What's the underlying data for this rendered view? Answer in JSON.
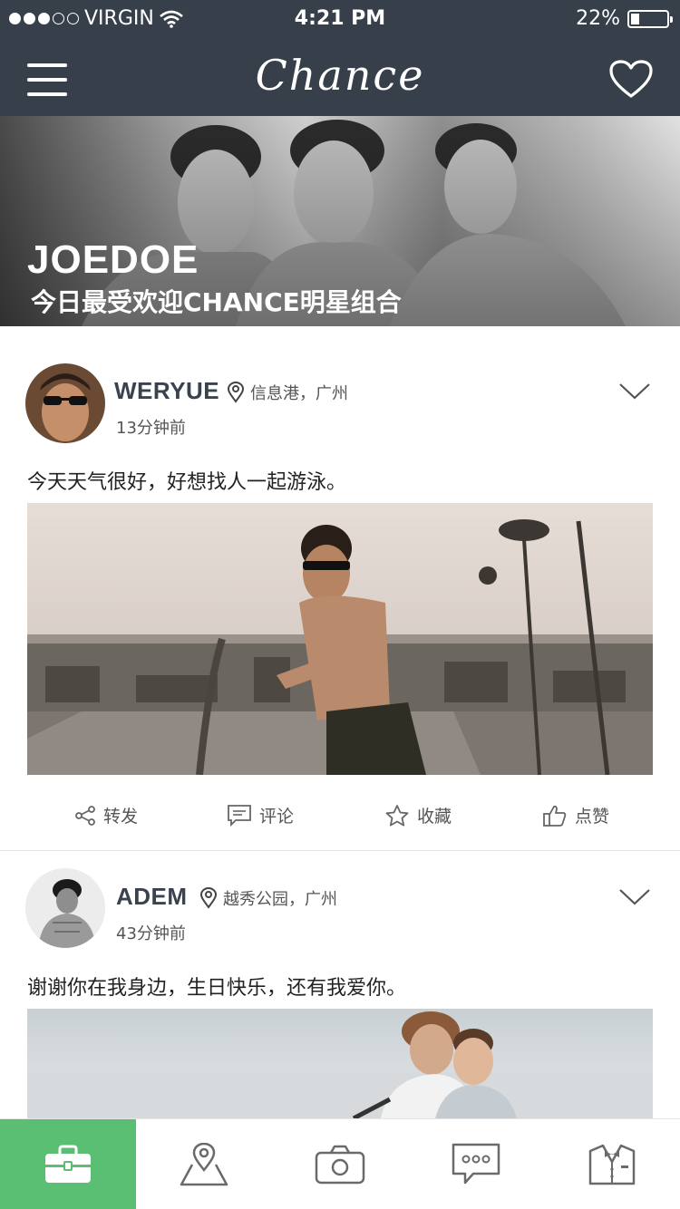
{
  "status_bar": {
    "carrier": "VIRGIN",
    "time": "4:21 PM",
    "battery": "22%",
    "battery_level": 0.22
  },
  "app": {
    "logo": "Chance",
    "menu_icon": "hamburger-icon",
    "heart_icon": "heart-icon",
    "header_color": "#363f4a"
  },
  "banner": {
    "title": "JOEDOE",
    "subtitle": "今日最受欢迎CHANCE明星组合"
  },
  "posts": [
    {
      "author": "WERYUE",
      "location": "信息港，广州",
      "time": "13分钟前",
      "text": "今天天气很好，好想找人一起游泳。",
      "actions": [
        "转发",
        "评论",
        "收藏",
        "点赞"
      ]
    },
    {
      "author": "ADEM",
      "location": "越秀公园，广州",
      "time": "43分钟前",
      "text": "谢谢你在我身边，生日快乐，还有我爱你。"
    }
  ],
  "tabbar": {
    "active_color": "#5bbf73",
    "items": [
      "briefcase-icon",
      "map-pin-icon",
      "camera-icon",
      "chat-icon",
      "tuxedo-icon"
    ]
  }
}
